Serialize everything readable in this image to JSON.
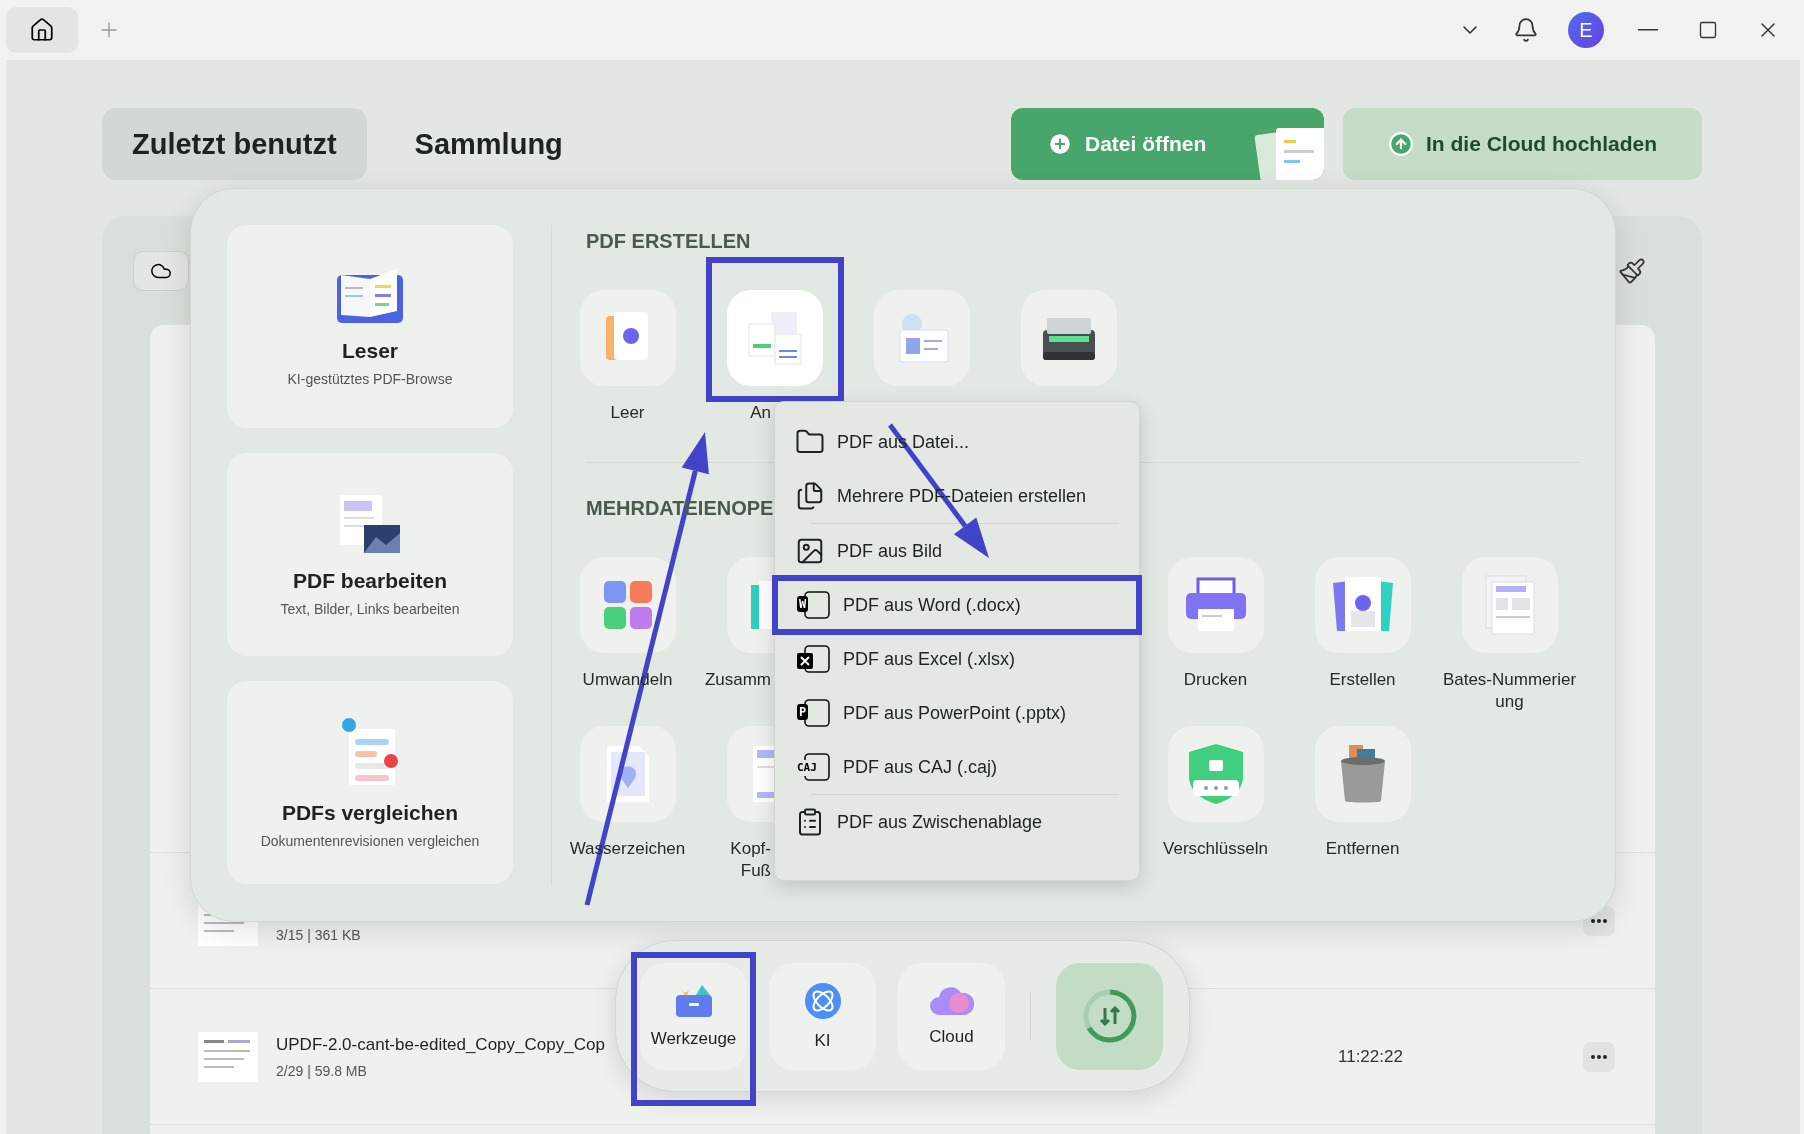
{
  "topbar": {
    "avatar": "E"
  },
  "tabs": [
    {
      "label": "Zuletzt benutzt",
      "selected": true
    },
    {
      "label": "Sammlung",
      "selected": false
    }
  ],
  "actions": [
    {
      "label": "Datei öffnen",
      "kind": "primary"
    },
    {
      "label": "In die Cloud hochladen",
      "kind": "secondary"
    }
  ],
  "files": [
    {
      "meta": "3/15 | 361 KB"
    },
    {
      "name": "UPDF-2.0-cant-be-edited_Copy_Copy_Cop",
      "meta": "2/29 | 59.8 MB",
      "time": "11:22:22"
    }
  ],
  "tools_panel": {
    "cards": [
      {
        "title": "Leser",
        "subtitle": "KI-gestütztes PDF-Browse"
      },
      {
        "title": "PDF bearbeiten",
        "subtitle": "Text, Bilder, Links bearbeiten"
      },
      {
        "title": "PDFs vergleichen",
        "subtitle": "Dokumentenrevisionen vergleichen"
      }
    ],
    "sections": [
      {
        "title": "PDF ERSTELLEN",
        "rows": [
          {
            "left": [
              {
                "label": "Leer",
                "highlighted": false
              },
              {
                "label": "An",
                "highlighted": true
              },
              {
                "highlighted": false
              },
              {
                "highlighted": false
              }
            ],
            "right": []
          }
        ]
      },
      {
        "title": "MEHRDATEIENOPE",
        "rows": [
          {
            "left": [
              {
                "label": "Umwandeln",
                "highlighted": false
              },
              {
                "label": "Zusamm",
                "highlighted": false
              }
            ],
            "right": [
              {
                "label": "Drucken",
                "highlighted": false
              },
              {
                "label": "Erstellen",
                "highlighted": false
              },
              {
                "label": "Bates-Nummerier\nung",
                "highlighted": false
              }
            ]
          },
          {
            "left": [
              {
                "label": "Wasserzeichen",
                "highlighted": false
              },
              {
                "label": "Kopf-\nFuß",
                "highlighted": false
              }
            ],
            "right": [
              {
                "label": "Verschlüsseln",
                "highlighted": false
              },
              {
                "label": "Entfernen",
                "highlighted": false
              }
            ]
          }
        ]
      }
    ]
  },
  "create_menu": {
    "groups": [
      [
        {
          "label": "PDF aus Datei...",
          "highlighted": false
        },
        {
          "label": "Mehrere PDF-Dateien erstellen",
          "highlighted": false
        }
      ],
      [
        {
          "label": "PDF aus Bild",
          "highlighted": false
        },
        {
          "label": "PDF aus Word (.docx)",
          "badge": "W",
          "highlighted": true
        },
        {
          "label": "PDF aus Excel (.xlsx)",
          "highlighted": false
        },
        {
          "label": "PDF aus PowerPoint (.pptx)",
          "badge": "P",
          "highlighted": false
        },
        {
          "label": "PDF aus CAJ (.caj)",
          "badge": "CAJ",
          "highlighted": false
        }
      ],
      [
        {
          "label": "PDF aus Zwischenablage",
          "highlighted": false
        }
      ]
    ]
  },
  "dock": [
    {
      "label": "Werkzeuge",
      "kind": "tools",
      "highlighted": true
    },
    {
      "label": "KI",
      "kind": "ai",
      "highlighted": false
    },
    {
      "label": "Cloud",
      "kind": "cloud",
      "highlighted": false
    },
    {
      "kind": "sync",
      "highlighted": false
    }
  ]
}
